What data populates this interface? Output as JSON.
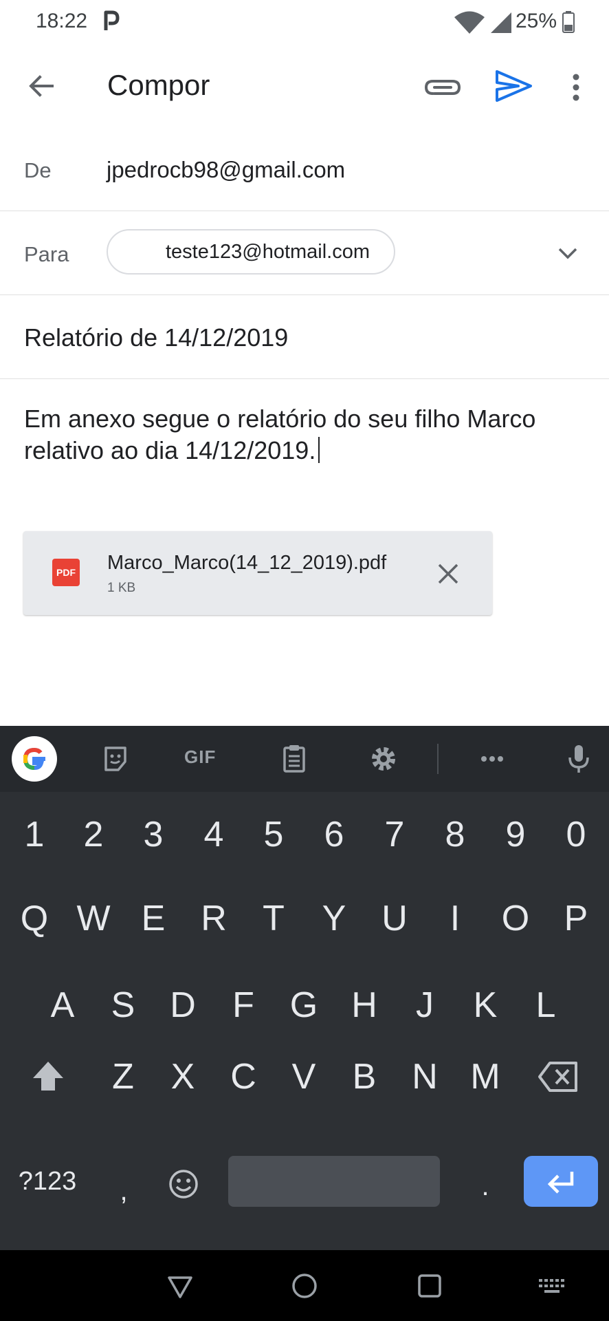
{
  "status_bar": {
    "time": "18:22",
    "battery": "25%"
  },
  "app_bar": {
    "title": "Compor"
  },
  "compose": {
    "from_label": "De",
    "from_value": "jpedrocb98@gmail.com",
    "to_label": "Para",
    "to_chip": "teste123@hotmail.com",
    "subject": "Relatório de 14/12/2019",
    "body": "Em anexo segue o relatório do seu filho Marco relativo ao dia 14/12/2019."
  },
  "attachment": {
    "filename": "Marco_Marco(14_12_2019).pdf",
    "size": "1 KB",
    "type_badge": "PDF"
  },
  "keyboard": {
    "toolbar_gif": "GIF",
    "row_numbers": [
      "1",
      "2",
      "3",
      "4",
      "5",
      "6",
      "7",
      "8",
      "9",
      "0"
    ],
    "row1": [
      "Q",
      "W",
      "E",
      "R",
      "T",
      "Y",
      "U",
      "I",
      "O",
      "P"
    ],
    "row2": [
      "A",
      "S",
      "D",
      "F",
      "G",
      "H",
      "J",
      "K",
      "L"
    ],
    "row3": [
      "Z",
      "X",
      "C",
      "V",
      "B",
      "N",
      "M"
    ],
    "symbols_key": "?123",
    "comma_key": ",",
    "period_key": "."
  },
  "colors": {
    "accent": "#1a73e8",
    "pdf_red": "#e94235",
    "keyboard_bg": "#2d3034",
    "enter_key": "#5e97f6"
  }
}
